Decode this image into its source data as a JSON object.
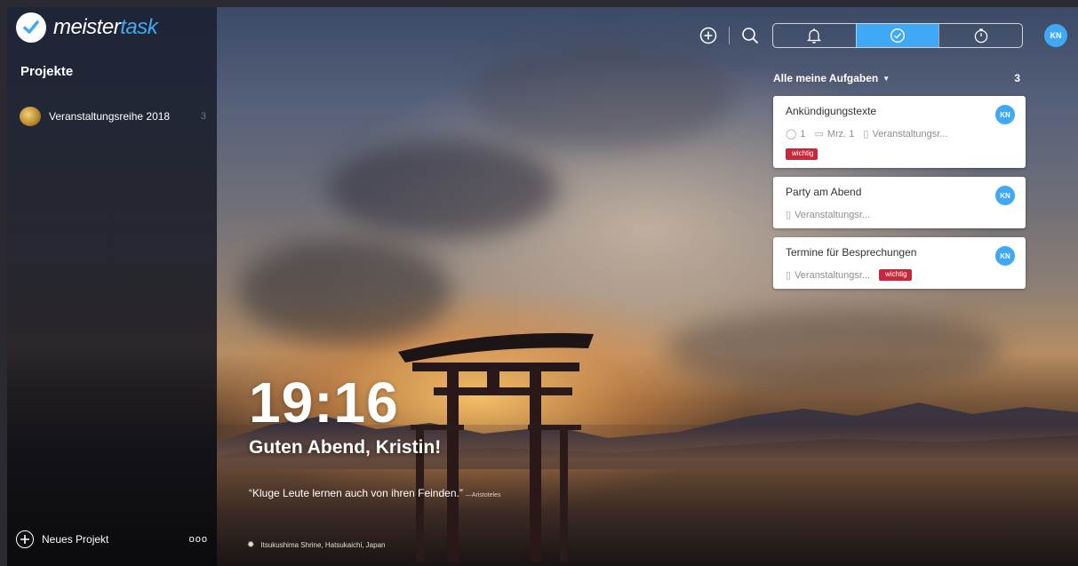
{
  "brand": {
    "name_part1": "meister",
    "name_part2": "task",
    "accent": "#3fa9f5"
  },
  "sidebar": {
    "heading": "Projekte",
    "projects": [
      {
        "name": "Veranstaltungsreihe 2018",
        "count": "3",
        "icon": "project-thumbnail"
      }
    ],
    "new_project_label": "Neues Projekt",
    "more_label": "ooo"
  },
  "toolbar": {
    "icons": [
      "add-icon",
      "search-icon"
    ],
    "segments": [
      {
        "icon": "bell-icon",
        "active": false
      },
      {
        "icon": "check-circle-icon",
        "active": true
      },
      {
        "icon": "stopwatch-icon",
        "active": false
      }
    ],
    "user_initials": "KN"
  },
  "tasks": {
    "filter_label": "Alle meine Aufgaben",
    "count": "3",
    "items": [
      {
        "title": "Ankündigungstexte",
        "comments": "1",
        "due": "Mrz. 1",
        "project": "Veranstaltungsr...",
        "tag": "wichtig",
        "assignee": "KN"
      },
      {
        "title": "Party am Abend",
        "project": "Veranstaltungsr...",
        "assignee": "KN"
      },
      {
        "title": "Termine für Besprechungen",
        "project": "Veranstaltungsr...",
        "tag": "wichtig",
        "assignee": "KN"
      }
    ]
  },
  "dashboard": {
    "time": "19:16",
    "greeting": "Guten Abend, Kristin!",
    "quote": "“Kluge Leute lernen auch von ihren Feinden.”",
    "quote_author": "—Aristoteles",
    "location": "Itsukushima Shrine, Hatsukaichi, Japan"
  },
  "colors": {
    "tag": "#c8283b",
    "active_segment": "#3fa9f5"
  }
}
